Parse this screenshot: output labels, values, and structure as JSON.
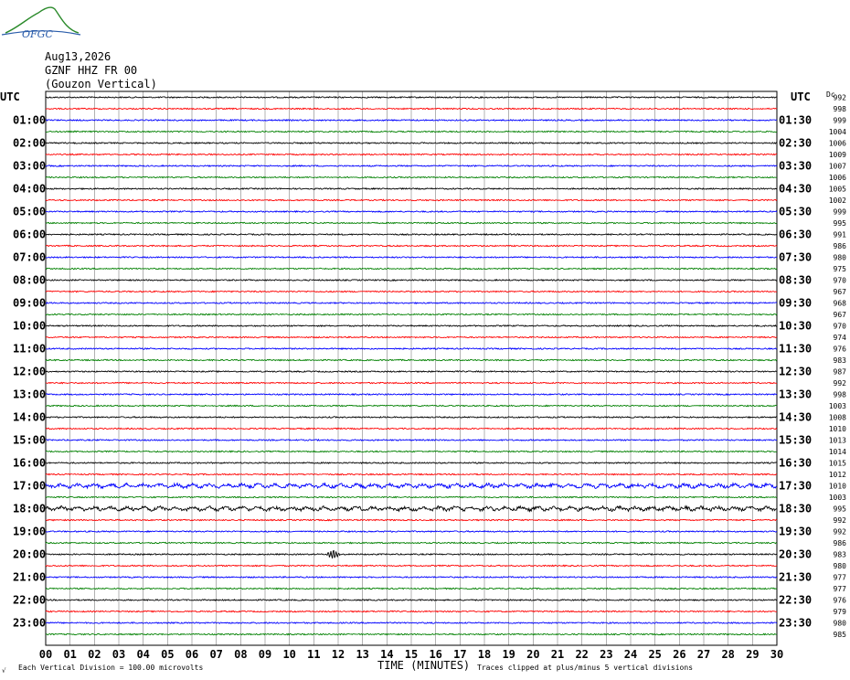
{
  "header": {
    "date": "Aug13,2026",
    "station_line": "GZNF HHZ FR 00",
    "station_name": "(Gouzon Vertical)",
    "logo_text": "OFGC"
  },
  "axis": {
    "left_title": "UTC",
    "right_title": "UTC",
    "corner_label": "Dc",
    "x_title": "TIME (MINUTES)",
    "footer_left": "Each Vertical Division =  100.00 microvolts",
    "footer_right": "Traces clipped at plus/minus 5 vertical divisions",
    "footer_mark": "√"
  },
  "colors": {
    "cycle": [
      "#000000",
      "#ff0000",
      "#0000ff",
      "#008000"
    ],
    "grid": "#808080"
  },
  "chart_data": {
    "type": "line",
    "x_label": "TIME (MINUTES)",
    "x_range": [
      0,
      30
    ],
    "x_ticks": [
      "00",
      "01",
      "02",
      "03",
      "04",
      "05",
      "06",
      "07",
      "08",
      "09",
      "10",
      "11",
      "12",
      "13",
      "14",
      "15",
      "16",
      "17",
      "18",
      "19",
      "20",
      "21",
      "22",
      "23",
      "24",
      "25",
      "26",
      "27",
      "28",
      "29",
      "30"
    ],
    "rows_count": 48,
    "left_labels": [
      "01:00",
      "02:00",
      "03:00",
      "04:00",
      "05:00",
      "06:00",
      "07:00",
      "08:00",
      "09:00",
      "10:00",
      "11:00",
      "12:00",
      "13:00",
      "14:00",
      "15:00",
      "16:00",
      "17:00",
      "18:00",
      "19:00",
      "20:00",
      "21:00",
      "22:00",
      "23:00"
    ],
    "right_labels": [
      "01:30",
      "02:30",
      "03:30",
      "04:30",
      "05:30",
      "06:30",
      "07:30",
      "08:30",
      "09:30",
      "10:30",
      "11:30",
      "12:30",
      "13:30",
      "14:30",
      "15:30",
      "16:30",
      "17:30",
      "18:30",
      "19:30",
      "20:30",
      "21:30",
      "22:30",
      "23:30"
    ],
    "dc_offsets": [
      992,
      998,
      999,
      1004,
      1006,
      1009,
      1007,
      1006,
      1005,
      1002,
      999,
      995,
      991,
      986,
      980,
      975,
      970,
      967,
      968,
      967,
      970,
      974,
      976,
      983,
      987,
      992,
      998,
      1003,
      1008,
      1010,
      1013,
      1014,
      1015,
      1012,
      1010,
      1003,
      995,
      992,
      992,
      986,
      983,
      980,
      977,
      977,
      976,
      979,
      980,
      985
    ],
    "events": [
      {
        "row": 40,
        "minute": 11.8,
        "note": "red spike near 20:00-20:30"
      }
    ],
    "noisy_rows": [
      34,
      36
    ]
  }
}
